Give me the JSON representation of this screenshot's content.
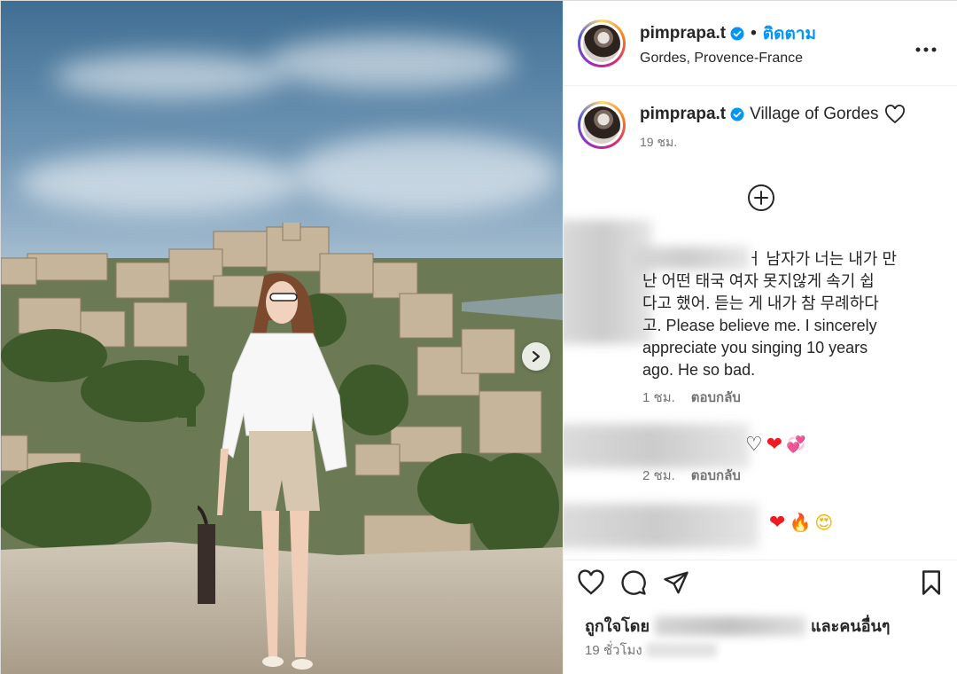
{
  "post": {
    "username": "pimprapa.t",
    "follow_label": "ติดตาม",
    "separator": "•",
    "location": "Gordes, Provence-France",
    "more_icon": "more-horizontal-icon"
  },
  "caption": {
    "username": "pimprapa.t",
    "text": "Village of Gordes",
    "time": "19 ชม."
  },
  "comments": [
    {
      "text_lines": [
        "ㅓ 남자가 너는 내가 만",
        "난 어떤 태국 여자 못지않게 속기 쉽",
        "다고 했어. 듣는 게 내가 참 무례하다",
        "고. Please believe me. I sincerely",
        "appreciate you singing 10 years",
        "ago. He so bad."
      ],
      "time": "1 ชม.",
      "reply_label": "ตอบกลับ"
    },
    {
      "emojis": [
        "♡",
        "❤",
        "💞"
      ],
      "time": "2 ชม.",
      "reply_label": "ตอบกลับ"
    },
    {
      "emojis": [
        "❤",
        "🔥",
        "😍"
      ]
    }
  ],
  "likes": {
    "prefix": "ถูกใจโดย",
    "suffix": "และคนอื่นๆ"
  },
  "timestamp": {
    "text": "19 ชั่วโมง"
  },
  "colors": {
    "accent": "#0095f6",
    "verified": "#0095f6",
    "heart_red": "#ed1c24"
  }
}
